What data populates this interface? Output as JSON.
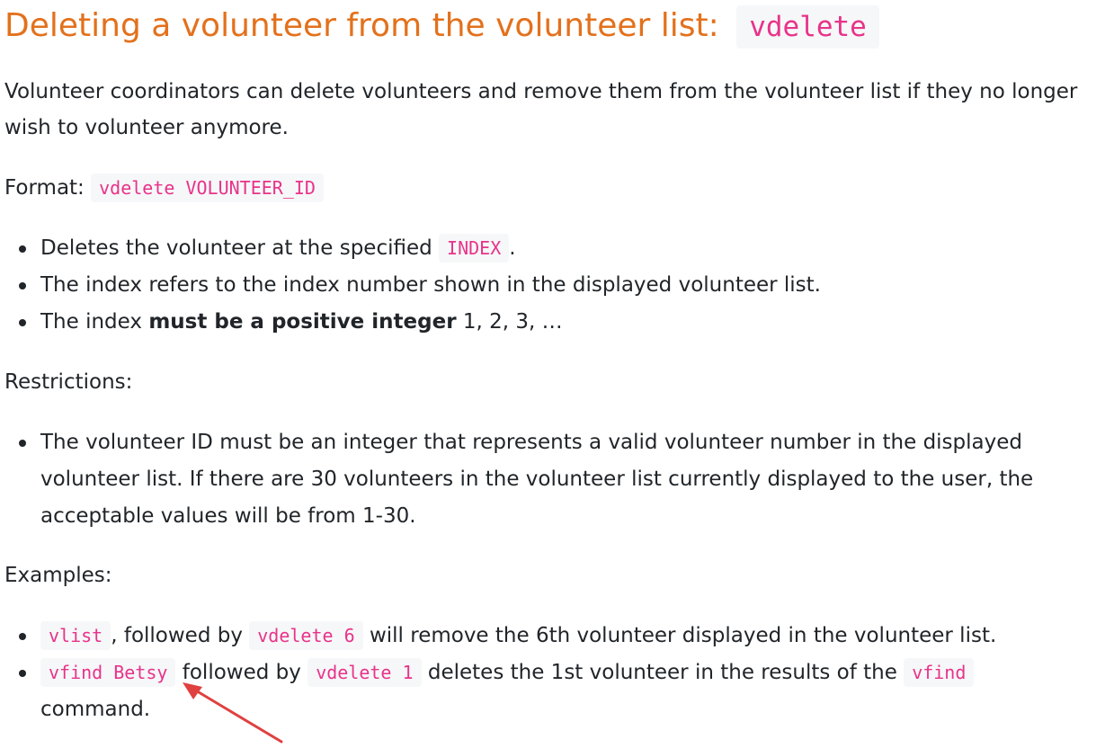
{
  "heading": {
    "text": "Deleting a volunteer from the volunteer list:",
    "command": "vdelete"
  },
  "intro": "Volunteer coordinators can delete volunteers and remove them from the volunteer list if they no longer wish to volunteer anymore.",
  "format": {
    "label": "Format:",
    "code": "vdelete VOLUNTEER_ID"
  },
  "details": {
    "item1_before": "Deletes the volunteer at the specified",
    "item1_code": "INDEX",
    "item1_after": ".",
    "item2": "The index refers to the index number shown in the displayed volunteer list.",
    "item3_before": "The index",
    "item3_bold": "must be a positive integer",
    "item3_after": "1, 2, 3, …"
  },
  "restrictions": {
    "label": "Restrictions:",
    "item1": "The volunteer ID must be an integer that represents a valid volunteer number in the displayed volunteer list. If there are 30 volunteers in the volunteer list currently displayed to the user, the acceptable values will be from 1-30."
  },
  "examples": {
    "label": "Examples:",
    "ex1_code1": "vlist",
    "ex1_text1": ", followed by",
    "ex1_code2": "vdelete 6",
    "ex1_text2": "will remove the 6th volunteer displayed in the volunteer list.",
    "ex2_code1": "vfind Betsy",
    "ex2_text1": "followed by",
    "ex2_code2": "vdelete 1",
    "ex2_text2": "deletes the 1st volunteer in the results of the",
    "ex2_code3": "vfind",
    "ex2_text3": "command."
  },
  "annotation": {
    "arrow_color": "#e04040",
    "arrow_icon": "arrow-pointer-icon"
  }
}
